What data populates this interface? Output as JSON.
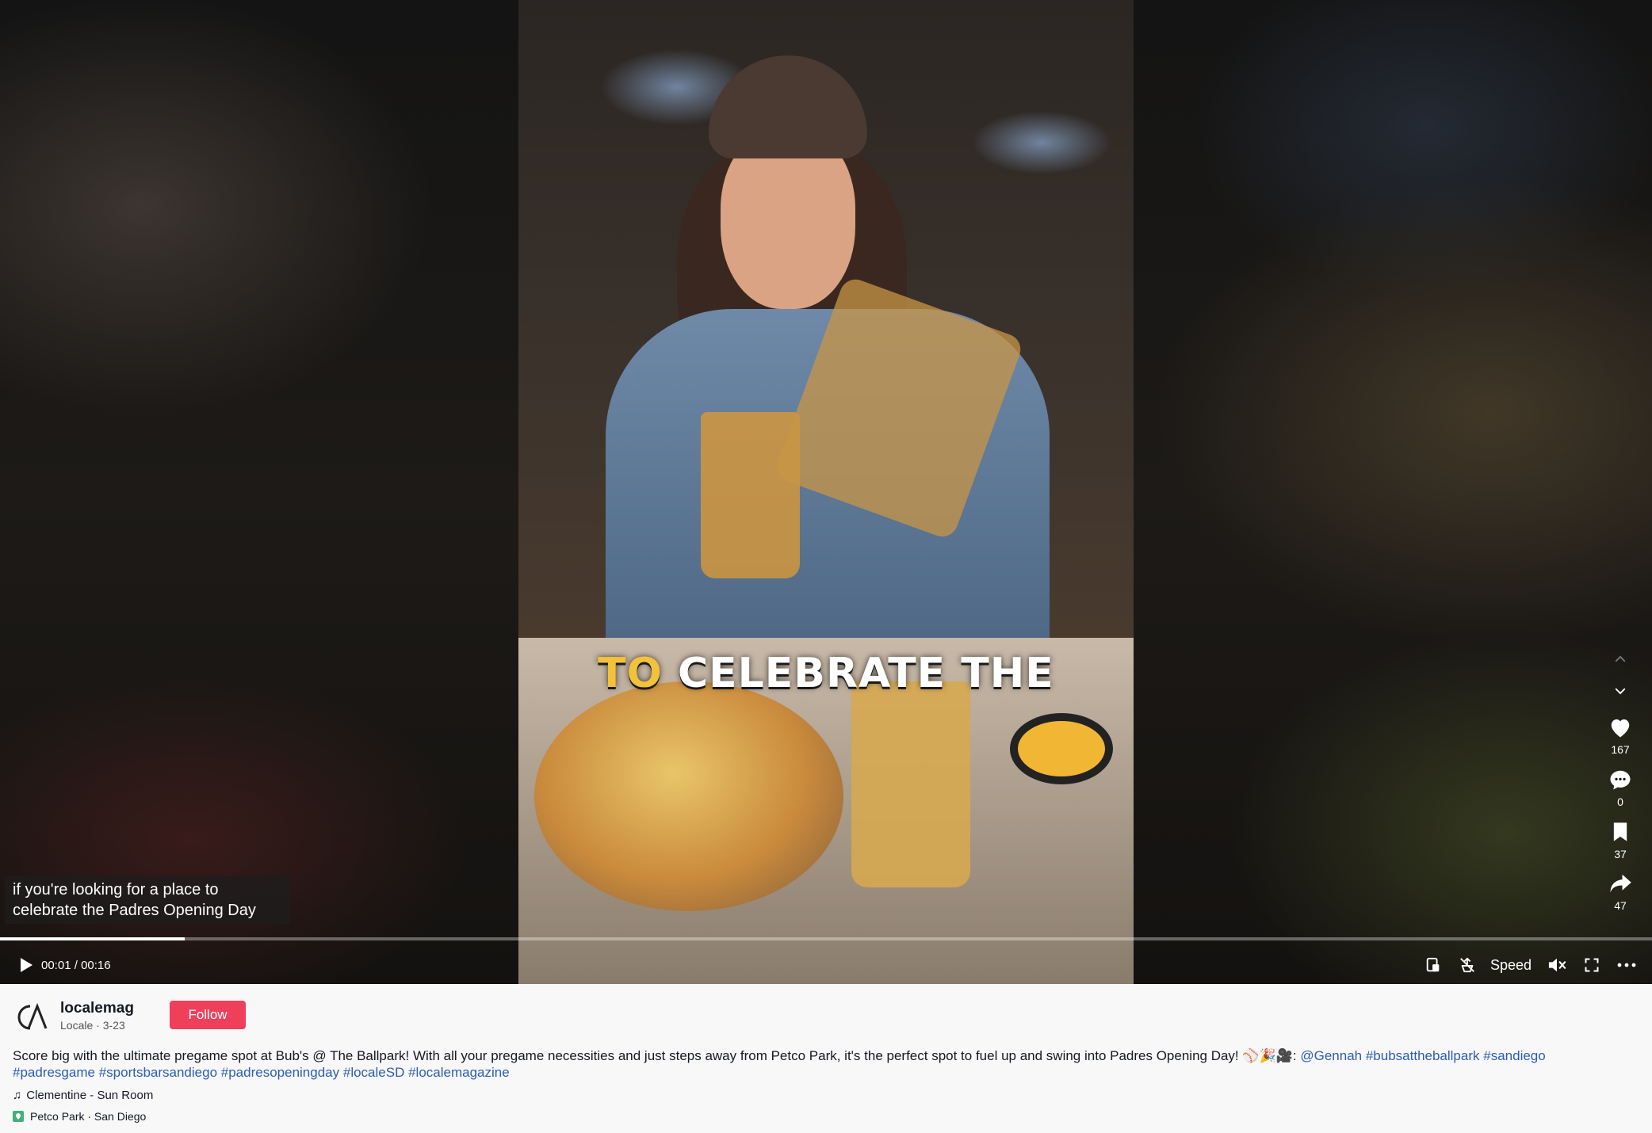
{
  "video": {
    "overlay_caption_highlight": "TO",
    "overlay_caption_rest": "CELEBRATE THE",
    "subtitle_line1": "if you're looking for a place to",
    "subtitle_line2": "celebrate the Padres Opening Day",
    "progress_fraction": 0.112,
    "current_time": "00:01",
    "separator": " / ",
    "duration": "00:16"
  },
  "controls": {
    "speed_label": "Speed",
    "icons": [
      "play-icon",
      "miniplayer-icon",
      "no-interest-icon",
      "mute-icon",
      "fullscreen-icon",
      "more-icon"
    ]
  },
  "side_actions": {
    "likes": "167",
    "comments": "0",
    "saves": "37",
    "shares": "47"
  },
  "post": {
    "username": "localemag",
    "display_name": "Locale",
    "meta_separator": " · ",
    "date": "3-23",
    "follow_label": "Follow",
    "description": "Score big with the ultimate pregame spot at Bub's @ The Ballpark! With all your pregame necessities and just steps away from Petco Park, it's the perfect spot to fuel up and swing into Padres Opening Day! ⚾🎉🎥: ",
    "tags": [
      "@Gennah",
      "#bubsattheballpark",
      "#sandiego",
      "#padresgame",
      "#sportsbarsandiego",
      "#padresopeningday",
      "#localeSD",
      "#localemagazine"
    ],
    "music": "Clementine - Sun Room",
    "location": "Petco Park · San Diego"
  },
  "colors": {
    "follow_button": "#ef3f5b",
    "hashtag": "#2b5db6",
    "caption_highlight": "#f2c23a"
  }
}
